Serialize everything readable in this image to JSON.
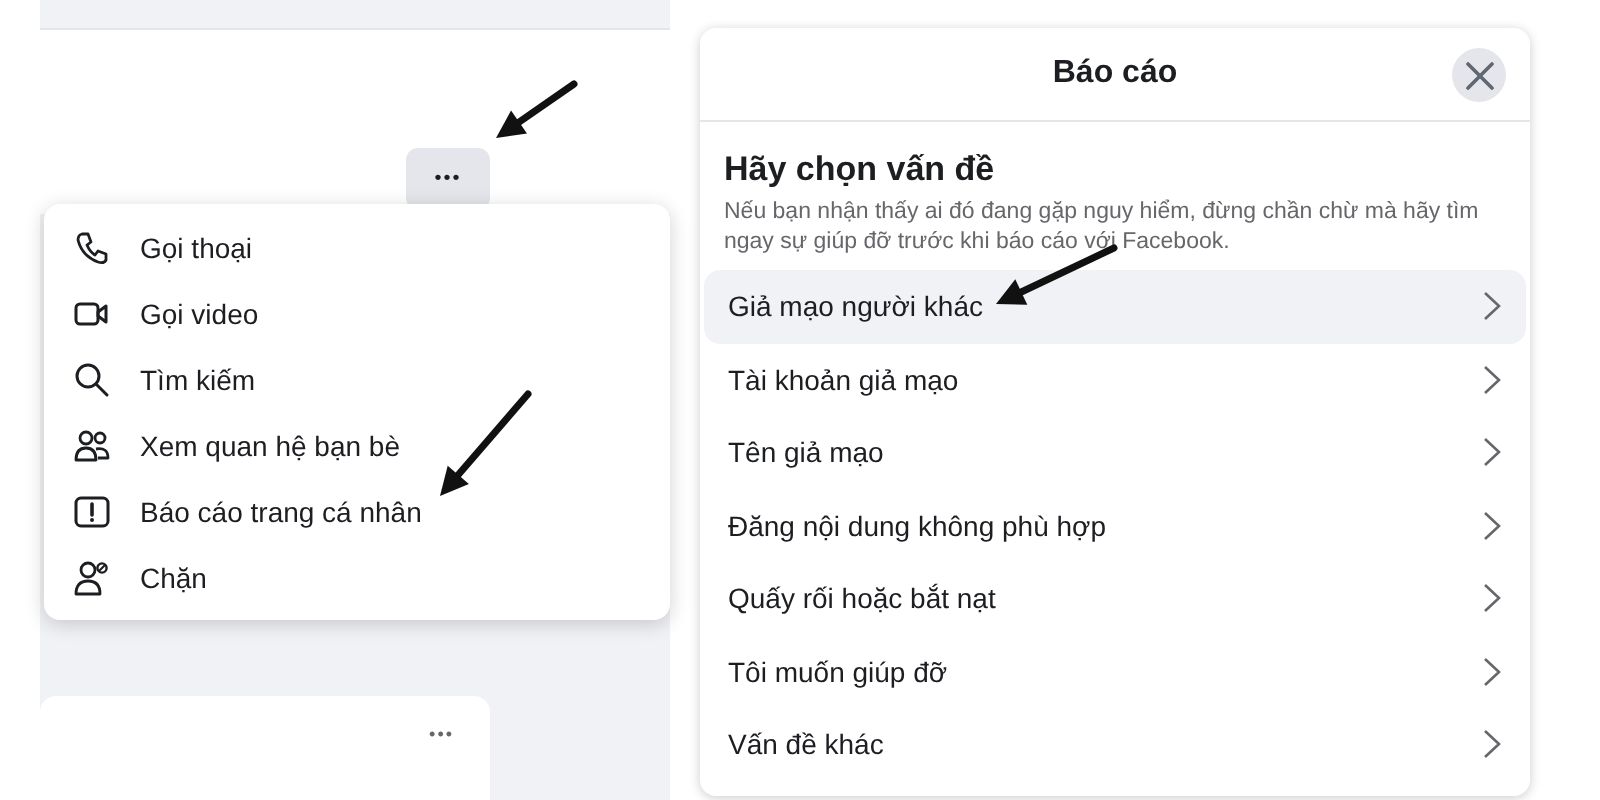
{
  "profile_panel": {
    "more_button": "•••",
    "menu": [
      {
        "label": "Gọi thoại"
      },
      {
        "label": "Gọi video"
      },
      {
        "label": "Tìm kiếm"
      },
      {
        "label": "Xem quan hệ bạn bè"
      },
      {
        "label": "Báo cáo trang cá nhân"
      },
      {
        "label": "Chặn"
      }
    ],
    "card_more_button": "•••"
  },
  "report_dialog": {
    "title": "Báo cáo",
    "heading": "Hãy chọn vấn đề",
    "description": "Nếu bạn nhận thấy ai đó đang gặp nguy hiểm, đừng chần chừ mà hãy tìm ngay sự giúp đỡ trước khi báo cáo với Facebook.",
    "options": [
      {
        "label": "Giả mạo người khác",
        "selected": true
      },
      {
        "label": "Tài khoản giả mạo",
        "selected": false
      },
      {
        "label": "Tên giả mạo",
        "selected": false
      },
      {
        "label": "Đăng nội dung không phù hợp",
        "selected": false
      },
      {
        "label": "Quấy rối hoặc bắt nạt",
        "selected": false
      },
      {
        "label": "Tôi muốn giúp đỡ",
        "selected": false
      },
      {
        "label": "Vấn đề khác",
        "selected": false
      }
    ]
  }
}
